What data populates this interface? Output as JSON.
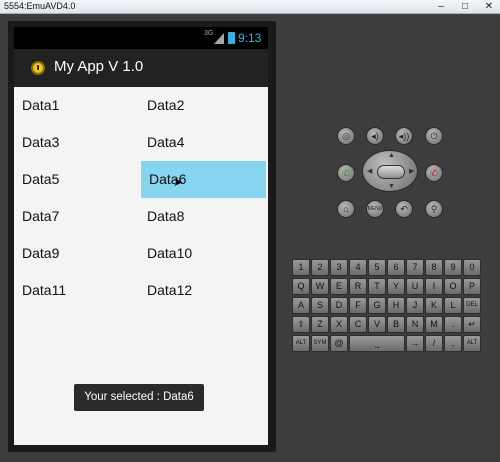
{
  "window": {
    "title": "5554:EmuAVD4.0",
    "minimize": "–",
    "maximize": "□",
    "close": "✕"
  },
  "statusbar": {
    "network": "3G",
    "time": "9:13"
  },
  "actionbar": {
    "title": "My App V 1.0",
    "icon": "clock-app-icon"
  },
  "grid": {
    "cells": [
      "Data1",
      "Data2",
      "Data3",
      "Data4",
      "Data5",
      "Data6",
      "Data7",
      "Data8",
      "Data9",
      "Data10",
      "Data11",
      "Data12"
    ],
    "selected": "Data6"
  },
  "toast": {
    "text": "Your selected : Data6"
  },
  "controls": {
    "camera": "◎",
    "vol_down": "◂)",
    "vol_up": "◂))",
    "power": "⏻",
    "call": "✆",
    "end_call": "✆",
    "home": "⌂",
    "menu": "MENU",
    "back": "↶",
    "search": "⚲"
  },
  "keyboard": {
    "row1": [
      "1",
      "2",
      "3",
      "4",
      "5",
      "6",
      "7",
      "8",
      "9",
      "0"
    ],
    "row2": [
      "Q",
      "W",
      "E",
      "R",
      "T",
      "Y",
      "U",
      "I",
      "O",
      "P"
    ],
    "row3": [
      "A",
      "S",
      "D",
      "F",
      "G",
      "H",
      "J",
      "K",
      "L",
      "DEL"
    ],
    "row4": [
      "⇧",
      "Z",
      "X",
      "C",
      "V",
      "B",
      "N",
      "M",
      ".",
      "↵"
    ],
    "row5_alt": "ALT",
    "row5_sym": "SYM",
    "row5_at": "@",
    "row5_space": "⎵",
    "row5_arrow": "→",
    "row5_slash": "/",
    "row5_comma": ",",
    "row5_alt2": "ALT"
  },
  "colors": {
    "selected_bg": "#87d4ef",
    "actionbar_bg": "#222222",
    "clock_color": "#33b5e5"
  }
}
